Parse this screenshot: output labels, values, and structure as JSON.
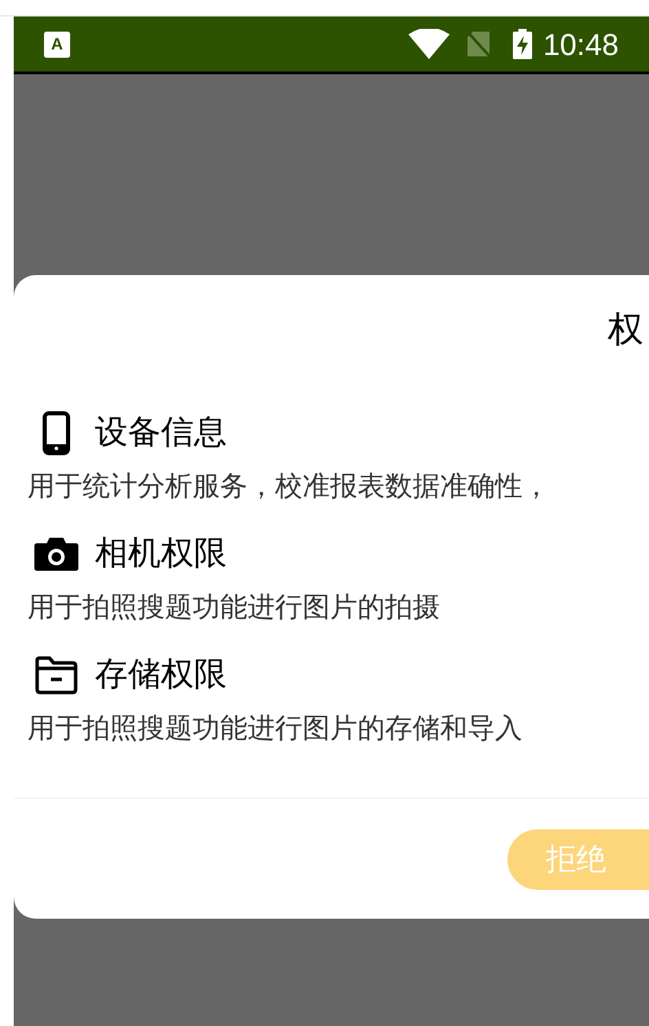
{
  "status_bar": {
    "notification_letter": "A",
    "time": "10:48"
  },
  "dialog": {
    "title": "权",
    "items": [
      {
        "kind": "phone",
        "title": "设备信息",
        "description": "用于统计分析服务，校准报表数据准确性，"
      },
      {
        "kind": "camera",
        "title": "相机权限",
        "description": "用于拍照搜题功能进行图片的拍摄"
      },
      {
        "kind": "folder",
        "title": "存储权限",
        "description": "用于拍照搜题功能进行图片的存储和导入"
      }
    ],
    "buttons": [
      {
        "label": "拒绝",
        "disabled": true
      }
    ]
  }
}
